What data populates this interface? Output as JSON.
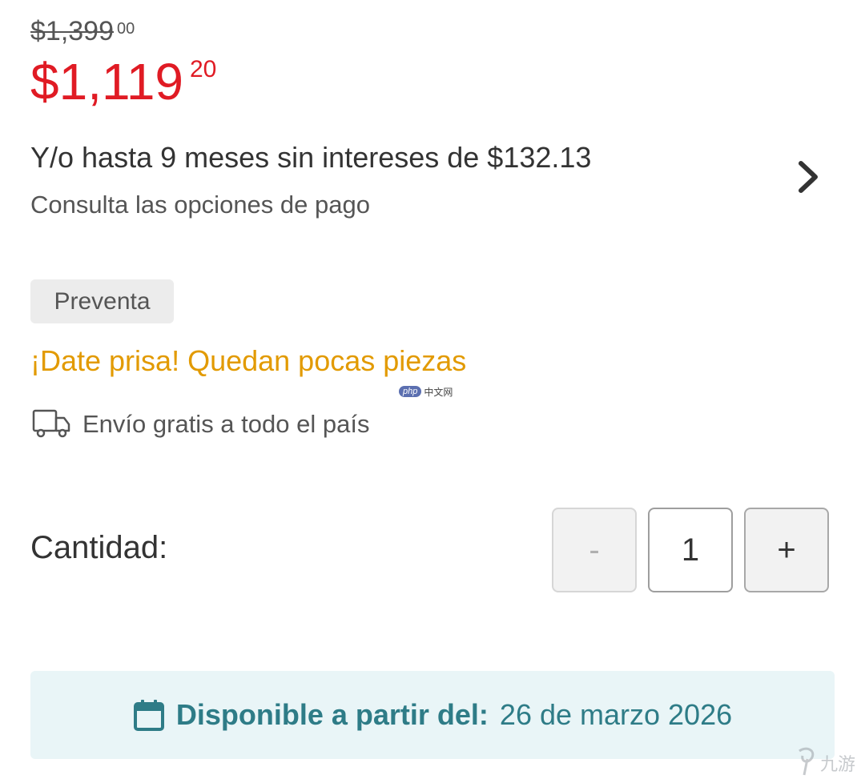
{
  "price": {
    "original_main": "$1,399",
    "original_cents": "00",
    "current_main": "$1,119",
    "current_cents": "20"
  },
  "installments": {
    "title": "Y/o hasta 9 meses sin intereses de $132.13",
    "subtitle": "Consulta las opciones de pago",
    "icon": "chevron-right-icon"
  },
  "badge": {
    "label": "Preventa"
  },
  "urgency": {
    "text": "¡Date prisa! Quedan pocas piezas"
  },
  "shipping": {
    "text": "Envío gratis a todo el país",
    "icon": "truck-icon"
  },
  "quantity": {
    "label": "Cantidad:",
    "minus_label": "-",
    "value": "1",
    "plus_label": "+"
  },
  "availability": {
    "label": "Disponible a partir del:",
    "date": "26 de marzo 2026",
    "icon": "calendar-icon"
  },
  "watermarks": {
    "php_pill": "php",
    "php_text": "中文网",
    "corner_logo": "九游"
  },
  "colors": {
    "current_price": "#e01b24",
    "urgency": "#e29a00",
    "availability_text": "#2e7c87",
    "availability_bg": "#e9f5f7",
    "badge_bg": "#ececec"
  }
}
